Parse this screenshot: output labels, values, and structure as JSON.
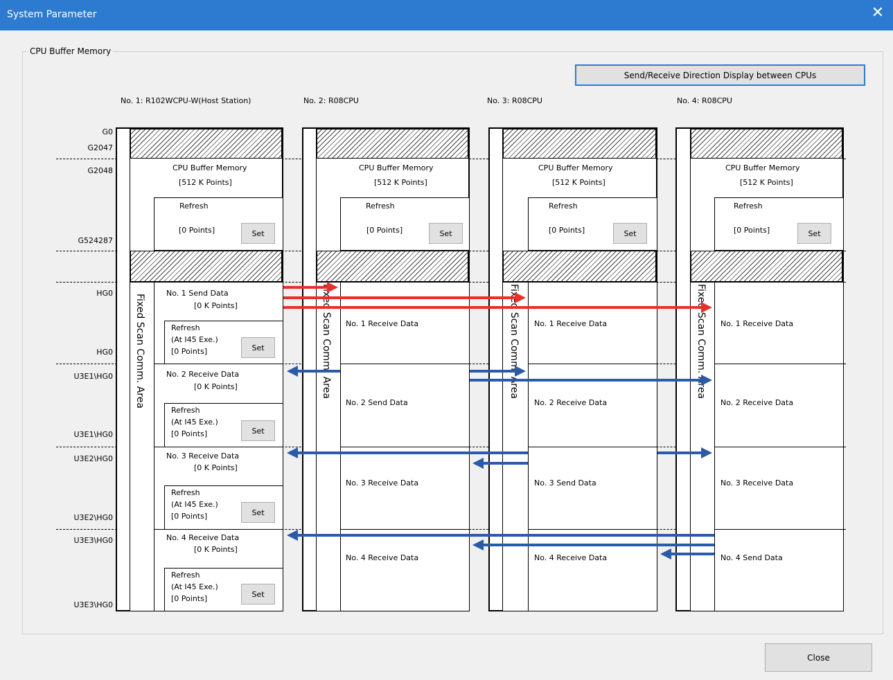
{
  "window": {
    "title": "System Parameter",
    "close_glyph": "✕"
  },
  "group": {
    "label": "CPU Buffer Memory"
  },
  "buttons": {
    "direction_display": "Send/Receive Direction Display between CPUs",
    "close": "Close",
    "set": "Set"
  },
  "cpus": [
    {
      "header": "No. 1: R102WCPU-W(Host Station)"
    },
    {
      "header": "No. 2: R08CPU"
    },
    {
      "header": "No. 3: R08CPU"
    },
    {
      "header": "No. 4: R08CPU"
    }
  ],
  "addresses": {
    "g0": "G0",
    "g2047": "G2047",
    "g2048": "G2048",
    "g524287": "G524287",
    "hg0_a": "HG0",
    "hg0_b": "HG0",
    "u3e1_a": "U3E1\\HG0",
    "u3e1_b": "U3E1\\HG0",
    "u3e2_a": "U3E2\\HG0",
    "u3e2_b": "U3E2\\HG0",
    "u3e3_a": "U3E3\\HG0",
    "u3e3_b": "U3E3\\HG0"
  },
  "buffer": {
    "title": "CPU Buffer Memory",
    "size": "[512 K Points]"
  },
  "refresh": {
    "title": "Refresh",
    "points": "[0 Points]",
    "at_exe": "(At I45 Exe.)"
  },
  "fixed_scan": "Fixed Scan Comm. Area",
  "host_rows": [
    {
      "title": "No. 1 Send Data",
      "size": "[0 K Points]"
    },
    {
      "title": "No. 2 Receive Data",
      "size": "[0 K Points]"
    },
    {
      "title": "No. 3 Receive Data",
      "size": "[0 K Points]"
    },
    {
      "title": "No. 4 Receive Data",
      "size": "[0 K Points]"
    }
  ],
  "other_rows": {
    "cpu2": [
      "No. 1 Receive Data",
      "No. 2 Send Data",
      "No. 3 Receive Data",
      "No. 4 Receive Data"
    ],
    "cpu3": [
      "No. 1 Receive Data",
      "No. 2 Receive Data",
      "No. 3 Send Data",
      "No. 4 Receive Data"
    ],
    "cpu4": [
      "No. 1 Receive Data",
      "No. 2 Receive Data",
      "No. 3 Receive Data",
      "No. 4 Send Data"
    ]
  },
  "colors": {
    "title_bar": "#2d7bd0",
    "send_arrow_host": "#e8302a",
    "send_arrow_other": "#2a5aa8"
  }
}
